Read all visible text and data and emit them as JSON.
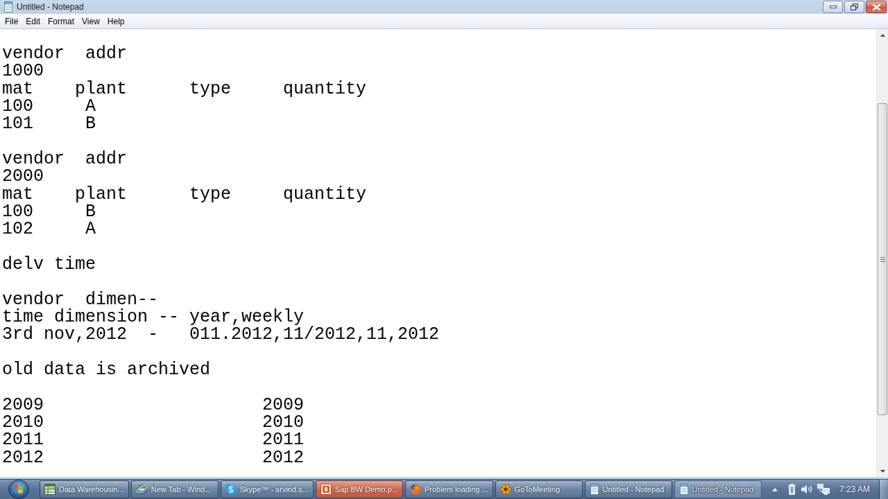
{
  "window": {
    "title": "Untitled - Notepad"
  },
  "menu": [
    {
      "label": "File"
    },
    {
      "label": "Edit"
    },
    {
      "label": "Format"
    },
    {
      "label": "View"
    },
    {
      "label": "Help"
    }
  ],
  "document": {
    "blocks": [
      [
        "vendor  addr",
        "1000",
        "mat    plant      type     quantity",
        "100     A",
        "101     B"
      ],
      [
        "vendor  addr",
        "2000",
        "mat    plant      type     quantity",
        "100     B",
        "102     A"
      ],
      [
        "delv time"
      ],
      [
        "vendor  dimen--",
        "time dimension -- year,weekly",
        "3rd nov,2012  -   011.2012,11/2012,11,2012"
      ],
      [
        "old data is archived"
      ],
      [
        "2009                     2009",
        "2010                     2010",
        "2011                     2011",
        "2012                     2012"
      ]
    ]
  },
  "taskbar": {
    "buttons": [
      {
        "label": "Data Warehousin...",
        "kind": "table",
        "selected": false,
        "highlighted": false
      },
      {
        "label": "New Tab - Wind...",
        "kind": "browser",
        "selected": false,
        "highlighted": false
      },
      {
        "label": "Skype™ - arvind.s...",
        "kind": "chat",
        "selected": false,
        "highlighted": false
      },
      {
        "label": "Sap BW Demo.p...",
        "kind": "slides",
        "selected": false,
        "highlighted": true
      },
      {
        "label": "Problem loading ...",
        "kind": "globe",
        "selected": false,
        "highlighted": false
      },
      {
        "label": "GoToMeeting",
        "kind": "flower",
        "selected": false,
        "highlighted": false
      },
      {
        "label": "Untitled - Notepad",
        "kind": "notepad",
        "selected": false,
        "highlighted": false
      },
      {
        "label": "Untitled - Notepad",
        "kind": "notepad",
        "selected": true,
        "highlighted": false
      }
    ],
    "clock": "7:23 AM"
  }
}
